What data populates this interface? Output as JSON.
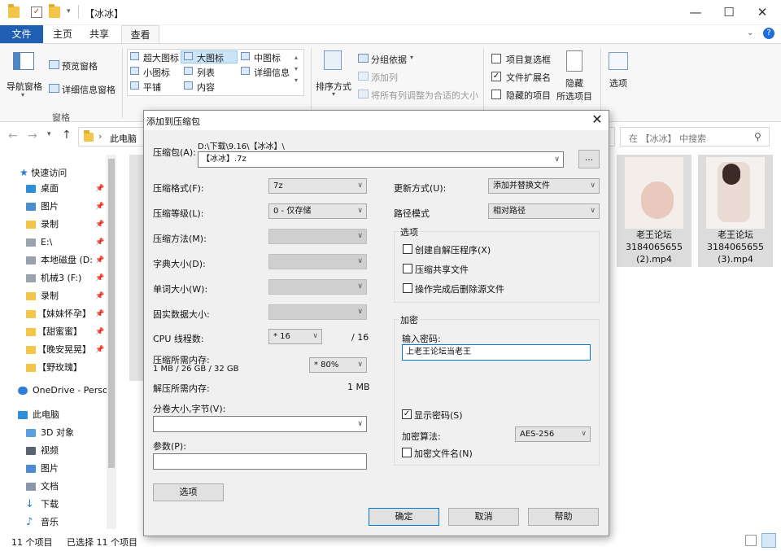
{
  "window": {
    "title": "【冰冰】",
    "minimize": "—",
    "maximize": "☐",
    "close": "✕"
  },
  "ribbon_tabs": [
    "文件",
    "主页",
    "共享",
    "查看"
  ],
  "ribbon": {
    "nav_pane": "导航窗格",
    "preview_pane": "预览窗格",
    "details_pane": "详细信息窗格",
    "panes_group": "窗格",
    "layout": [
      "超大图标",
      "大图标",
      "中图标",
      "小图标",
      "列表",
      "详细信息",
      "平铺",
      "内容"
    ],
    "sort_by": "排序方式",
    "group_by": "分组依据",
    "add_column": "添加列",
    "fit_columns": "将所有列调整为合适的大小",
    "item_checkboxes": "项目复选框",
    "file_extensions": "文件扩展名",
    "hidden_items": "隐藏的项目",
    "hide_selected_1": "隐藏",
    "hide_selected_2": "所选项目",
    "options": "选项"
  },
  "address": {
    "path": "此电脑",
    "search_placeholder": "在 【冰冰】 中搜索"
  },
  "nav": {
    "quick_access": "快速访问",
    "items": [
      {
        "label": "桌面",
        "pinned": true
      },
      {
        "label": "图片",
        "pinned": true
      },
      {
        "label": "录制",
        "pinned": true
      },
      {
        "label": "E:\\",
        "pinned": true
      },
      {
        "label": "本地磁盘 (D:",
        "pinned": true
      },
      {
        "label": "机械3 (F:)",
        "pinned": true
      },
      {
        "label": "录制",
        "pinned": true
      },
      {
        "label": "【妹妹怀孕】",
        "pinned": true
      },
      {
        "label": "【甜蜜蜜】",
        "pinned": true
      },
      {
        "label": "【晚安晃晃】",
        "pinned": true
      },
      {
        "label": "【野玫瑰】",
        "pinned": false
      }
    ],
    "onedrive": "OneDrive - Perso",
    "this_pc": "此电脑",
    "pc_items": [
      "3D 对象",
      "视频",
      "图片",
      "文档",
      "下载",
      "音乐"
    ]
  },
  "files": [
    {
      "name_1": "老王论坛",
      "name_2": "3184065655",
      "name_3": "(2).mp4"
    },
    {
      "name_1": "老王论坛",
      "name_2": "3184065655",
      "name_3": "(3).mp4"
    }
  ],
  "status": {
    "count": "11 个项目",
    "selected": "已选择 11 个项目"
  },
  "dialog": {
    "title": "添加到压缩包",
    "close": "✕",
    "archive_label": "压缩包(A):",
    "archive_path": "D:\\下载\\9.16\\【冰冰】\\",
    "archive_name": "【冰冰】.7z",
    "browse": "...",
    "format_label": "压缩格式(F):",
    "format_value": "7z",
    "level_label": "压缩等级(L):",
    "level_value": "0 - 仅存储",
    "method_label": "压缩方法(M):",
    "dict_label": "字典大小(D):",
    "word_label": "单词大小(W):",
    "solid_label": "固实数据大小:",
    "threads_label": "CPU 线程数:",
    "threads_value": "* 16",
    "threads_total": "/ 16",
    "mem_label": "压缩所需内存:",
    "mem_detail": "1 MB / 26 GB / 32 GB",
    "mem_value": "* 80%",
    "decomp_label": "解压所需内存:",
    "decomp_value": "1 MB",
    "split_label": "分卷大小,字节(V):",
    "params_label": "参数(P):",
    "options_btn": "选项",
    "update_label": "更新方式(U):",
    "update_value": "添加并替换文件",
    "path_label": "路径模式",
    "path_value": "相对路径",
    "options_group": "选项",
    "opt_sfx": "创建自解压程序(X)",
    "opt_shared": "压缩共享文件",
    "opt_delete": "操作完成后删除源文件",
    "encrypt_group": "加密",
    "password_label": "输入密码:",
    "password_value": "上老王论坛当老王",
    "show_password": "显示密码(S)",
    "enc_method_label": "加密算法:",
    "enc_method_value": "AES-256",
    "encrypt_names": "加密文件名(N)",
    "ok": "确定",
    "cancel": "取消",
    "help": "帮助"
  }
}
